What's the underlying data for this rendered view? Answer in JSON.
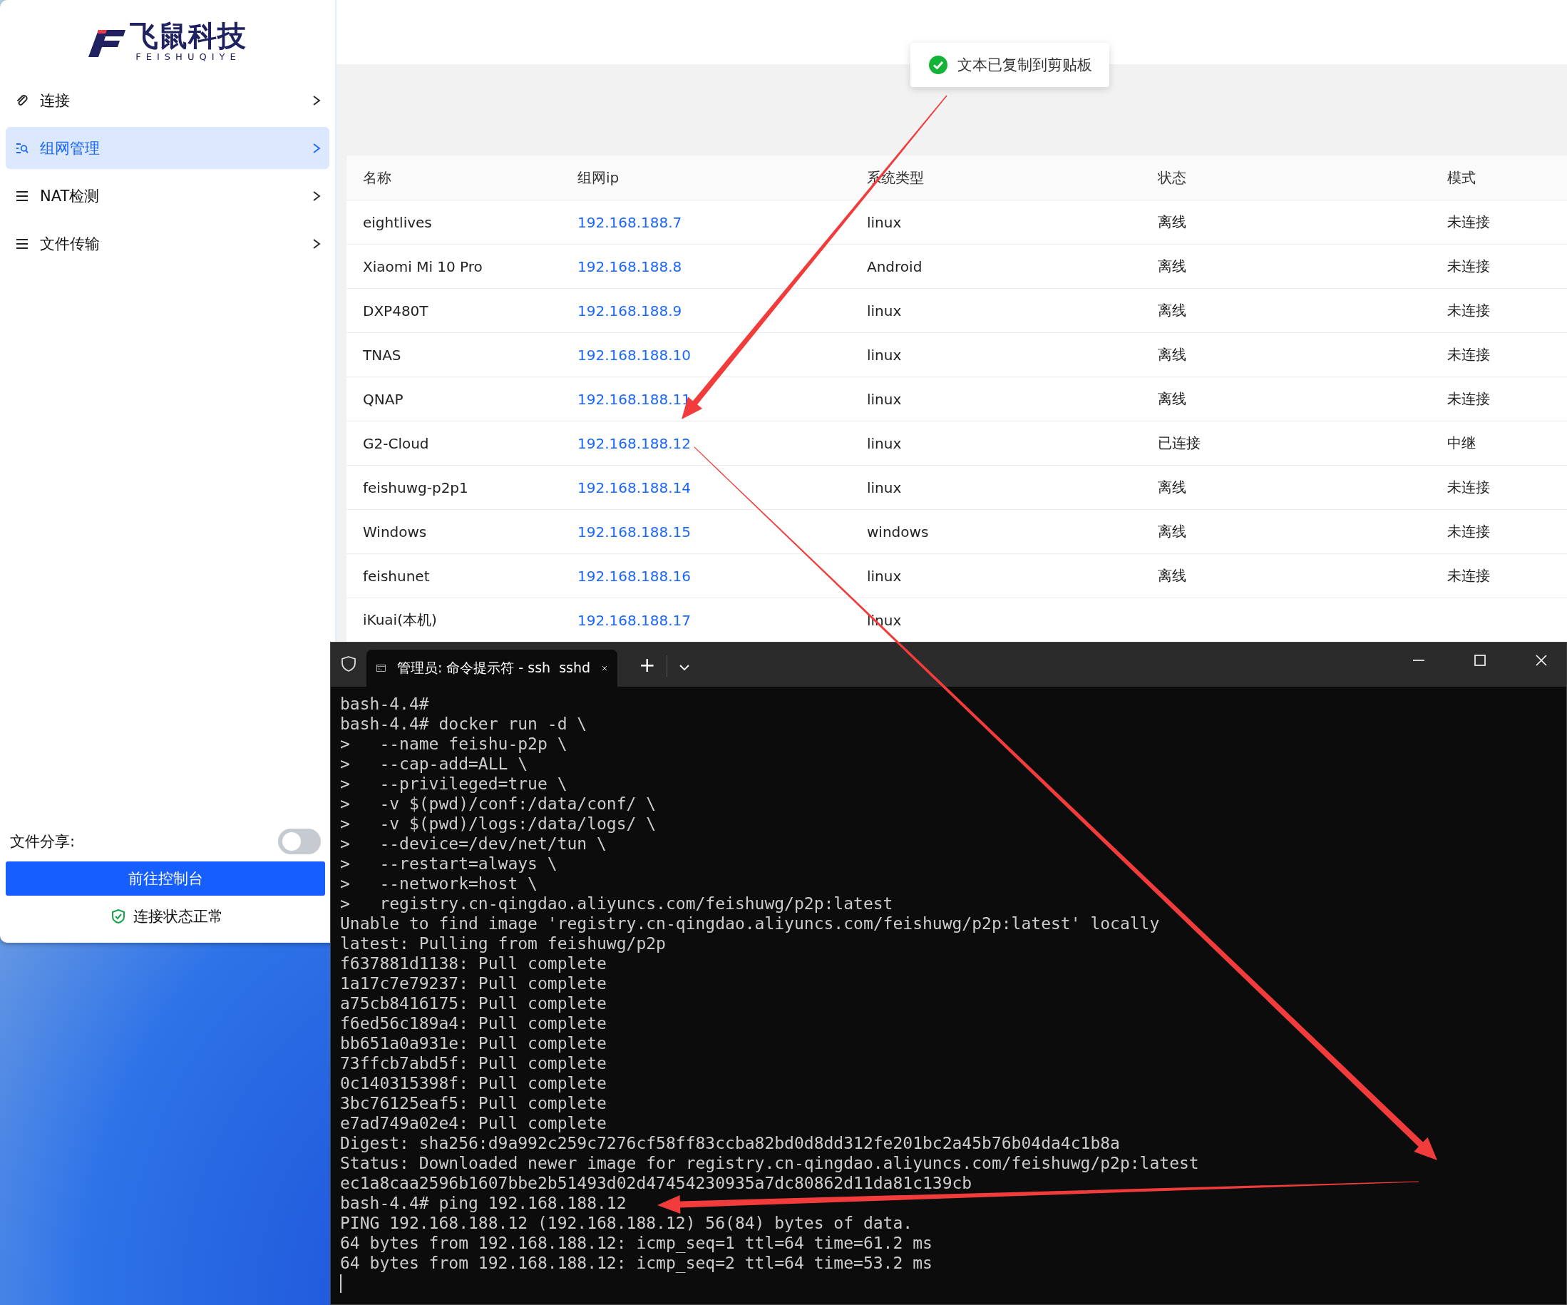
{
  "sidebar": {
    "logo": {
      "name": "飞鼠科技",
      "subtitle": "FEISHUQIYE"
    },
    "items": [
      {
        "label": "连接",
        "kind": "link",
        "selected": false
      },
      {
        "label": "组网管理",
        "kind": "network",
        "selected": true
      },
      {
        "label": "NAT检测",
        "kind": "list",
        "selected": false
      },
      {
        "label": "文件传输",
        "kind": "list",
        "selected": false
      }
    ],
    "file_share": {
      "label": "文件分享:",
      "on": false
    },
    "console_button": "前往控制台",
    "status": "连接状态正常"
  },
  "toast": {
    "message": "文本已复制到剪贴板"
  },
  "table": {
    "columns": [
      "名称",
      "组网ip",
      "系统类型",
      "状态",
      "模式"
    ],
    "rows": [
      {
        "name": "eightlives",
        "ip": "192.168.188.7",
        "os": "linux",
        "status": "离线",
        "mode": "未连接"
      },
      {
        "name": "Xiaomi Mi 10 Pro",
        "ip": "192.168.188.8",
        "os": "Android",
        "status": "离线",
        "mode": "未连接"
      },
      {
        "name": "DXP480T",
        "ip": "192.168.188.9",
        "os": "linux",
        "status": "离线",
        "mode": "未连接"
      },
      {
        "name": "TNAS",
        "ip": "192.168.188.10",
        "os": "linux",
        "status": "离线",
        "mode": "未连接"
      },
      {
        "name": "QNAP",
        "ip": "192.168.188.11",
        "os": "linux",
        "status": "离线",
        "mode": "未连接"
      },
      {
        "name": "G2-Cloud",
        "ip": "192.168.188.12",
        "os": "linux",
        "status": "已连接",
        "mode": "中继"
      },
      {
        "name": "feishuwg-p2p1",
        "ip": "192.168.188.14",
        "os": "linux",
        "status": "离线",
        "mode": "未连接"
      },
      {
        "name": "Windows",
        "ip": "192.168.188.15",
        "os": "windows",
        "status": "离线",
        "mode": "未连接"
      },
      {
        "name": "feishunet",
        "ip": "192.168.188.16",
        "os": "linux",
        "status": "离线",
        "mode": "未连接"
      },
      {
        "name": "iKuai(本机)",
        "ip": "192.168.188.17",
        "os": "linux"
      }
    ]
  },
  "terminal": {
    "tab_title": "管理员: 命令提示符 - ssh  sshd",
    "tab_add": "+",
    "lines": [
      "bash-4.4#",
      "bash-4.4# docker run -d \\",
      ">   --name feishu-p2p \\",
      ">   --cap-add=ALL \\",
      ">   --privileged=true \\",
      ">   -v $(pwd)/conf:/data/conf/ \\",
      ">   -v $(pwd)/logs:/data/logs/ \\",
      ">   --device=/dev/net/tun \\",
      ">   --restart=always \\",
      ">   --network=host \\",
      ">   registry.cn-qingdao.aliyuncs.com/feishuwg/p2p:latest",
      "Unable to find image 'registry.cn-qingdao.aliyuncs.com/feishuwg/p2p:latest' locally",
      "latest: Pulling from feishuwg/p2p",
      "f637881d1138: Pull complete",
      "1a17c7e79237: Pull complete",
      "a75cb8416175: Pull complete",
      "f6ed56c189a4: Pull complete",
      "bb651a0a931e: Pull complete",
      "73ffcb7abd5f: Pull complete",
      "0c140315398f: Pull complete",
      "3bc76125eaf5: Pull complete",
      "e7ad749a02e4: Pull complete",
      "Digest: sha256:d9a992c259c7276cf58ff83ccba82bd0d8dd312fe201bc2a45b76b04da4c1b8a",
      "Status: Downloaded newer image for registry.cn-qingdao.aliyuncs.com/feishuwg/p2p:latest",
      "ec1a8caa2596b1607bbe2b51493d02d47454230935a7dc80862d11da81c139cb",
      "bash-4.4# ping 192.168.188.12",
      "PING 192.168.188.12 (192.168.188.12) 56(84) bytes of data.",
      "64 bytes from 192.168.188.12: icmp_seq=1 ttl=64 time=61.2 ms",
      "64 bytes from 192.168.188.12: icmp_seq=2 ttl=64 time=53.2 ms"
    ]
  }
}
